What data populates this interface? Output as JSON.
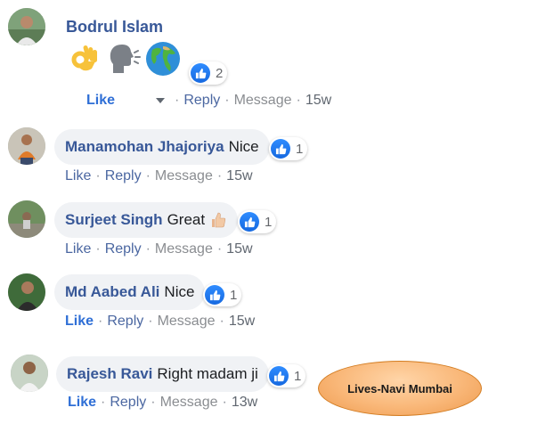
{
  "top_comment": {
    "author": "Bodrul Islam",
    "reaction_count": "2",
    "actions": {
      "like": "Like",
      "reply": "Reply",
      "message": "Message",
      "time": "15w"
    },
    "emojis": [
      "ok-hand-icon",
      "speaking-head-icon",
      "globe-icon"
    ]
  },
  "comments": [
    {
      "author": "Manamohan Jhajoriya",
      "text": "Nice",
      "reaction_count": "1",
      "actions": {
        "like": "Like",
        "reply": "Reply",
        "message": "Message",
        "time": "15w"
      }
    },
    {
      "author": "Surjeet Singh",
      "text": "Great",
      "reaction_count": "1",
      "actions": {
        "like": "Like",
        "reply": "Reply",
        "message": "Message",
        "time": "15w"
      }
    },
    {
      "author": "Md Aabed Ali",
      "text": "Nice",
      "reaction_count": "1",
      "actions": {
        "like": "Like",
        "reply": "Reply",
        "message": "Message",
        "time": "15w"
      }
    },
    {
      "author": "Rajesh Ravi",
      "text": "Right madam ji",
      "reaction_count": "1",
      "actions": {
        "like": "Like",
        "reply": "Reply",
        "message": "Message",
        "time": "13w"
      }
    }
  ],
  "overlay_label": "Lives-Navi Mumbai",
  "separator": "·",
  "colors": {
    "author": "#385898",
    "like_active": "#2f6fd6",
    "bubble": "#f0f2f5",
    "badge": "#f9b778"
  }
}
